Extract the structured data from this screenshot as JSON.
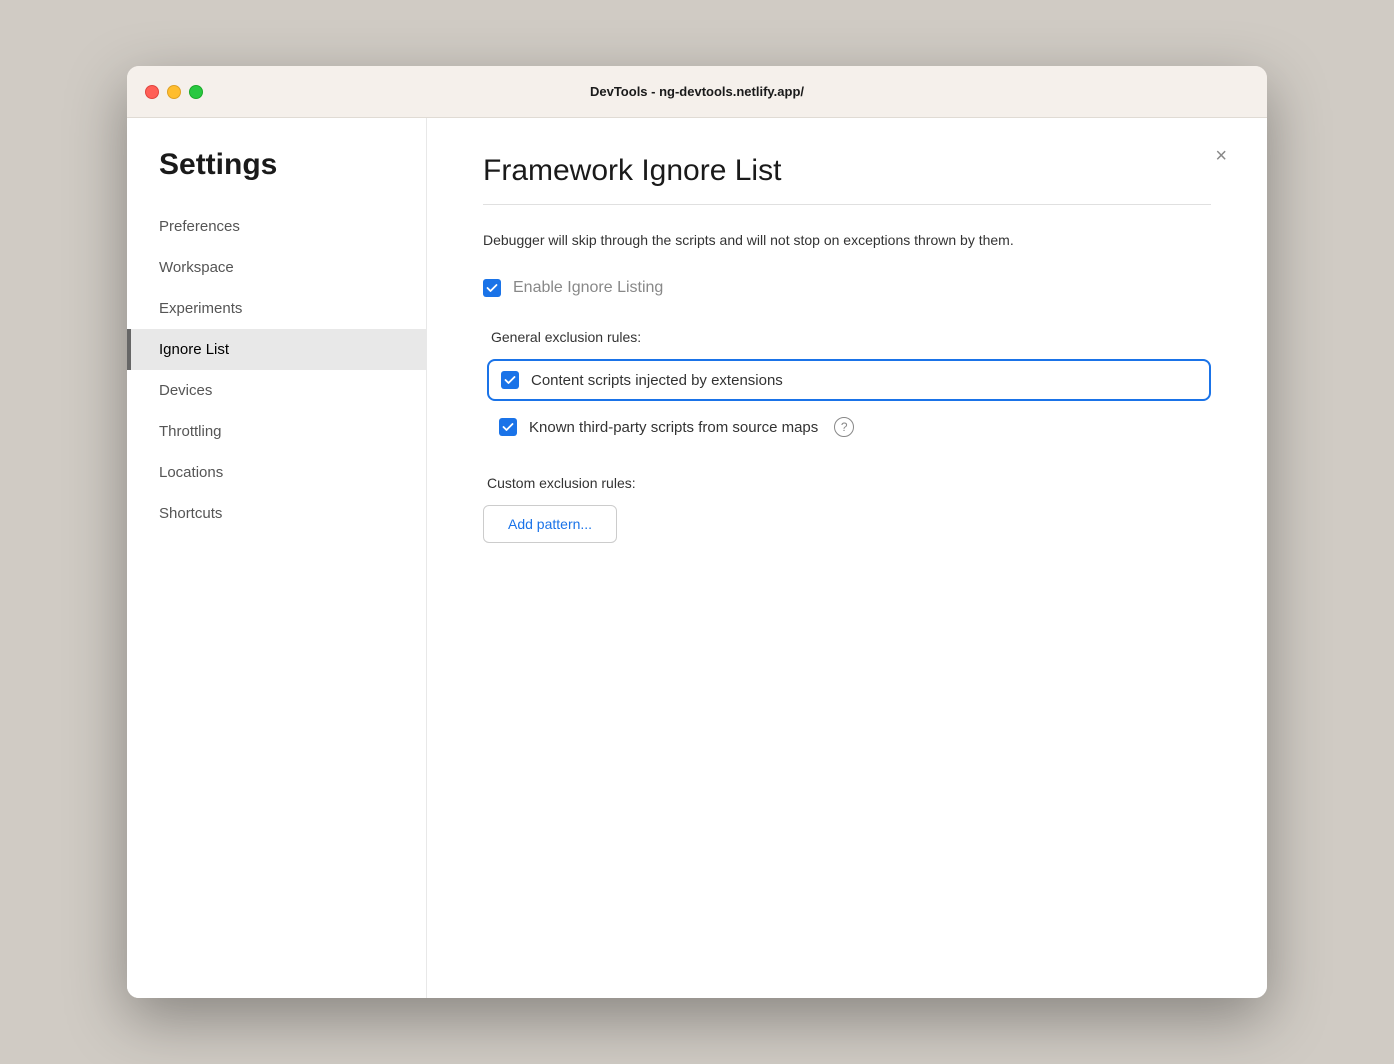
{
  "window": {
    "title": "DevTools - ng-devtools.netlify.app/"
  },
  "sidebar": {
    "heading": "Settings",
    "items": [
      {
        "id": "preferences",
        "label": "Preferences",
        "active": false
      },
      {
        "id": "workspace",
        "label": "Workspace",
        "active": false
      },
      {
        "id": "experiments",
        "label": "Experiments",
        "active": false
      },
      {
        "id": "ignore-list",
        "label": "Ignore List",
        "active": true
      },
      {
        "id": "devices",
        "label": "Devices",
        "active": false
      },
      {
        "id": "throttling",
        "label": "Throttling",
        "active": false
      },
      {
        "id": "locations",
        "label": "Locations",
        "active": false
      },
      {
        "id": "shortcuts",
        "label": "Shortcuts",
        "active": false
      }
    ]
  },
  "main": {
    "title": "Framework Ignore List",
    "description": "Debugger will skip through the scripts and will not stop on exceptions thrown by them.",
    "enable_label": "Enable Ignore Listing",
    "enable_checked": true,
    "general_section_label": "General exclusion rules:",
    "rules": [
      {
        "id": "content-scripts",
        "label": "Content scripts injected by extensions",
        "checked": true,
        "highlighted": true,
        "has_help": false
      },
      {
        "id": "third-party-scripts",
        "label": "Known third-party scripts from source maps",
        "checked": true,
        "highlighted": false,
        "has_help": true
      }
    ],
    "custom_section_label": "Custom exclusion rules:",
    "add_pattern_label": "Add pattern...",
    "close_label": "×"
  },
  "icons": {
    "checkmark": "✓"
  }
}
